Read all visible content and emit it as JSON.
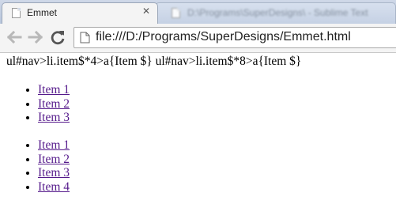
{
  "browser": {
    "tabs": [
      {
        "title": "Emmet",
        "active": true
      },
      {
        "title": "D:\\Programs\\SuperDesigns\\ - Sublime Text",
        "active": false
      }
    ],
    "address": "file:///D:/Programs/SuperDesigns/Emmet.html"
  },
  "page": {
    "abbreviation_text": "ul#nav>li.item$*4>a{Item $} ul#nav>li.item$*8>a{Item $}",
    "lists": [
      {
        "id": "nav",
        "items": [
          "Item 1",
          "Item 2",
          "Item 3"
        ]
      },
      {
        "id": "nav",
        "items": [
          "Item 1",
          "Item 2",
          "Item 3",
          "Item 4"
        ]
      }
    ],
    "link_color": "#551a8b"
  }
}
